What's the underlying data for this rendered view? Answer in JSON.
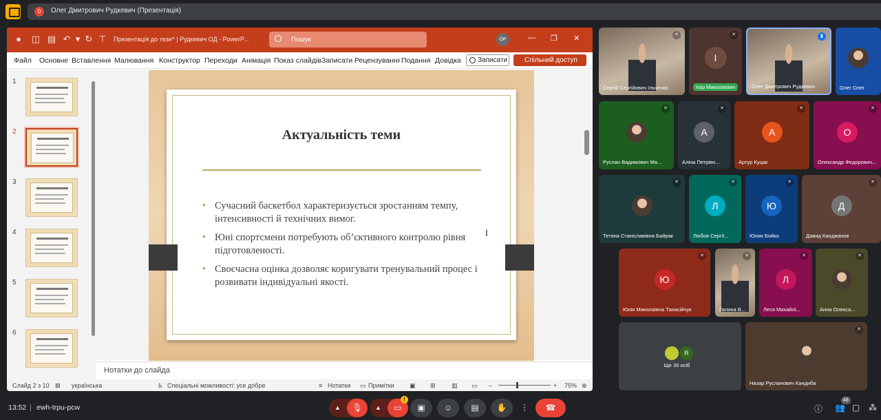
{
  "meet": {
    "presenter_badge": "0",
    "presenter_title": "Олег Дмитрович Рудкевич (Презентація)"
  },
  "ppt": {
    "doc_title": "Презентація до тези^ | Рудкевич ОД  -  PowerP...",
    "search_placeholder": "Пошук",
    "user_initials": "ОР",
    "tabs": [
      "Файл",
      "Основне",
      "Вставлення",
      "Малювання",
      "Конструктор",
      "Переходи",
      "Анімація",
      "Показ слайдів",
      "Записати",
      "Рецензування",
      "Подання",
      "Довідка"
    ],
    "record_label": "Записати",
    "share_label": "Спільний доступ",
    "slide_numbers": [
      "1",
      "2",
      "3",
      "4",
      "5",
      "6"
    ],
    "slide": {
      "title": "Актуальність теми",
      "bullets": [
        "Сучасний баскетбол характеризується зростанням темпу, інтенсивності й технічних вимог.",
        "Юні спортсмени потребують об’єктивного контролю рівня підготовленості.",
        "Своєчасна оцінка дозволяє коригувати тренувальний процес і розвивати індивідуальні якості."
      ]
    },
    "notes_label": "Нотатки до слайда",
    "status": {
      "slide_count": "Слайд 2 з 10",
      "language": "українська",
      "accessibility": "Спеціальні можливості: усе добре",
      "notes": "Нотатки",
      "comments": "Примітки",
      "zoom": "75%"
    }
  },
  "participants": [
    {
      "name": "Сергій Сергійович Ільченко",
      "type": "video"
    },
    {
      "name": "Ігор Миколаєвич",
      "initial": "І",
      "color": "#6d4c41",
      "type": "avatar",
      "speaking": true
    },
    {
      "name": "Олег Дмитрович Рудкевич",
      "type": "video"
    },
    {
      "name": "Олег Олег",
      "type": "photo"
    },
    {
      "name": "Руслан Вадимович Ма...",
      "type": "photo"
    },
    {
      "name": "Аліна Петрівн...",
      "initial": "А",
      "color": "#5f6368",
      "type": "avatar"
    },
    {
      "name": "Артур Куцак",
      "initial": "А",
      "color": "#e8541e",
      "type": "avatar"
    },
    {
      "name": "Олександр Федорович...",
      "initial": "О",
      "color": "#d81b60",
      "type": "avatar"
    },
    {
      "name": "Тетяна Станіславівна Байрак",
      "type": "photo"
    },
    {
      "name": "Любов Сергії...",
      "initial": "Л",
      "color": "#00acc1",
      "type": "avatar"
    },
    {
      "name": "Юлия Бойко",
      "initial": "Ю",
      "color": "#1565c0",
      "type": "avatar"
    },
    {
      "name": "Давид Канджанов",
      "initial": "Д",
      "color": "#757575",
      "type": "avatar"
    },
    {
      "name": "Юлія Миколаївна Танасійчук",
      "initial": "Ю",
      "color": "#c62828",
      "type": "avatar"
    },
    {
      "name": "Галина В...",
      "type": "video"
    },
    {
      "name": "Леся Михайлі...",
      "initial": "Л",
      "color": "#c2185b",
      "type": "avatar"
    },
    {
      "name": "Анна Олекса...",
      "type": "photo"
    },
    {
      "name": "Назар Русланович Кандиба",
      "type": "photo"
    }
  ],
  "more": {
    "label": "Ще 30 осіб",
    "initial": "Я"
  },
  "bottom": {
    "time": "13:52",
    "code": "ewh-trpu-pcw",
    "people_count": "48",
    "warn": "!"
  },
  "colors": {
    "ppt_accent": "#c43e1c",
    "leave": "#ea4335",
    "meet_bg": "#202124"
  }
}
